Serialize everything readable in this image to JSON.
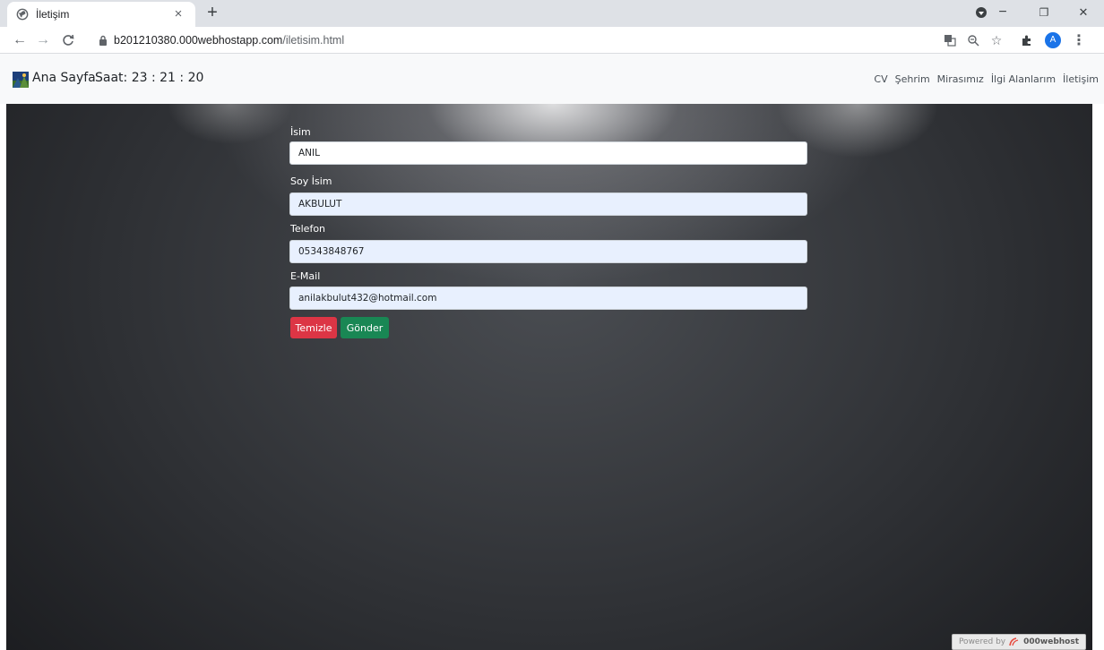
{
  "browser": {
    "tab": {
      "title": "İletişim",
      "close_glyph": "×"
    },
    "new_tab_glyph": "+",
    "window_controls": {
      "minimize": "−",
      "restore": "❐",
      "close": "✕"
    },
    "url": {
      "domain": "b201210380.000webhostapp.com",
      "path": "/iletisim.html"
    },
    "profile_initial": "A"
  },
  "navbar": {
    "brand": "Ana Sayfa",
    "clock": "Saat: 23 : 21 : 20",
    "links": [
      "CV",
      "Şehrim",
      "Mirasımız",
      "İlgi Alanlarım",
      "İletişim"
    ]
  },
  "form": {
    "first_name": {
      "label": "İsim",
      "value": "ANIL"
    },
    "last_name": {
      "label": "Soy İsim",
      "value": "AKBULUT"
    },
    "phone": {
      "label": "Telefon",
      "value": "05343848767"
    },
    "email": {
      "label": "E-Mail",
      "value": "anilakbulut432@hotmail.com"
    },
    "clear_button": "Temizle",
    "submit_button": "Gönder"
  },
  "footer": {
    "powered_by": "Powered by",
    "host_brand": "000webhost"
  },
  "colors": {
    "danger": "#dc3545",
    "success": "#198754",
    "navbar_bg": "#f8f9fa",
    "autofill_bg": "#e8f0fe"
  }
}
